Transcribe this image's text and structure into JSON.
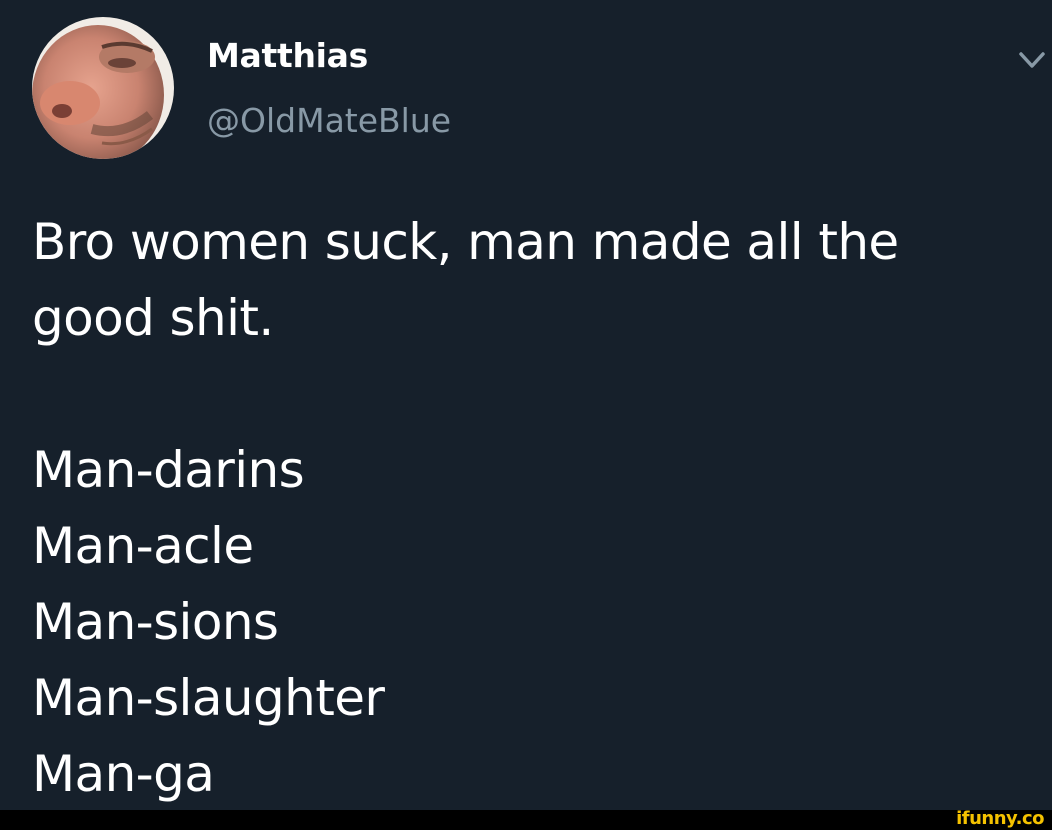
{
  "tweet": {
    "display_name": "Matthias",
    "handle": "@OldMateBlue",
    "text_lines": [
      "Bro women suck, man made all the",
      "good shit."
    ],
    "list_lines": [
      "Man-darins",
      "Man-acle",
      "Man-sions",
      "Man-slaughter",
      "Man-ga"
    ],
    "icons": {
      "menu": "chevron-down-icon",
      "avatar": "avatar"
    }
  },
  "watermark": {
    "text": "ifunny.co"
  },
  "colors": {
    "background": "#16202b",
    "text": "#ffffff",
    "handle": "#8899a6",
    "caret": "#8899a6",
    "watermark": "#f5c200",
    "footer": "#000000"
  }
}
